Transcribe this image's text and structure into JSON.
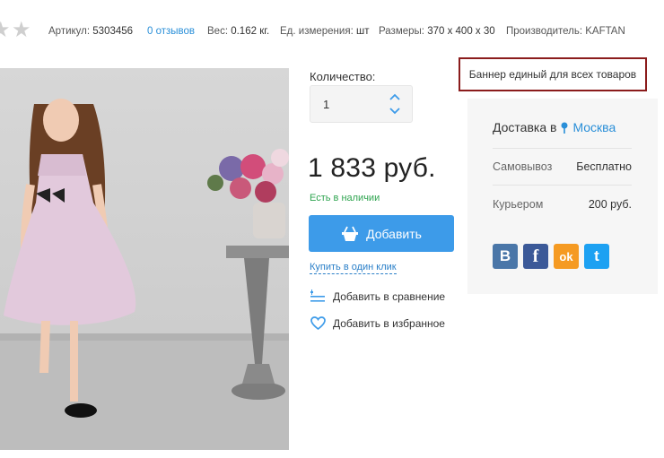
{
  "meta": {
    "article_label": "Артикул:",
    "article_value": "5303456",
    "reviews": "0 отзывов",
    "weight_label": "Вес:",
    "weight_value": "0.162 кг.",
    "unit_label": "Ед. измерения:",
    "unit_value": "шт",
    "size_label": "Размеры:",
    "size_value": "370 x 400 x 30",
    "maker": "Производитель: KAFTAN"
  },
  "quantity": {
    "label": "Количество:",
    "value": "1"
  },
  "price": "1 833 руб.",
  "stock": "Есть в наличии",
  "add_button": "Добавить",
  "one_click": "Купить в один клик",
  "compare": "Добавить в сравнение",
  "favorite": "Добавить в избранное",
  "banner": "Баннер единый для всех товаров",
  "delivery": {
    "title": "Доставка в",
    "city": "Москва",
    "rows": [
      {
        "label": "Самовывоз",
        "value": "Бесплатно"
      },
      {
        "label": "Курьером",
        "value": "200 руб."
      }
    ]
  },
  "social": [
    {
      "icon": "vk-icon",
      "glyph": "В",
      "color": "#4a76a8"
    },
    {
      "icon": "facebook-icon",
      "glyph": "f",
      "color": "#3b5998"
    },
    {
      "icon": "odnoklassniki-icon",
      "glyph": "ok",
      "color": "#f59a22"
    },
    {
      "icon": "twitter-icon",
      "glyph": "t",
      "color": "#1da1f2"
    }
  ],
  "colors": {
    "accent": "#3d9be9",
    "link": "#2a8fd8",
    "stock": "#2ea44f",
    "banner_border": "#8b1c1c"
  }
}
